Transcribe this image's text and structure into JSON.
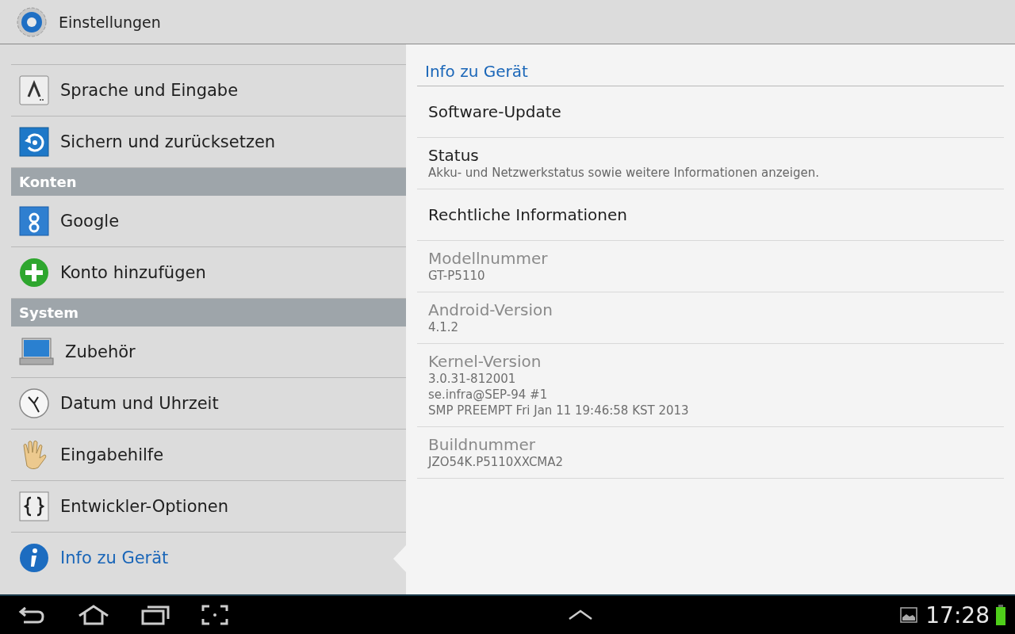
{
  "action_bar": {
    "title": "Einstellungen"
  },
  "sidebar": [
    {
      "kind": "item",
      "label": "Sprache und Eingabe",
      "selected": false
    },
    {
      "kind": "item",
      "label": "Sichern und zurücksetzen",
      "selected": false
    },
    {
      "kind": "header",
      "label": "Konten"
    },
    {
      "kind": "item",
      "label": "Google",
      "selected": false
    },
    {
      "kind": "item",
      "label": "Konto hinzufügen",
      "selected": false
    },
    {
      "kind": "header",
      "label": "System"
    },
    {
      "kind": "item",
      "label": "Zubehör",
      "selected": false
    },
    {
      "kind": "item",
      "label": "Datum und Uhrzeit",
      "selected": false
    },
    {
      "kind": "item",
      "label": "Eingabehilfe",
      "selected": false
    },
    {
      "kind": "item",
      "label": "Entwickler-Optionen",
      "selected": false
    },
    {
      "kind": "item",
      "label": "Info zu Gerät",
      "selected": true
    }
  ],
  "detail": {
    "title": "Info zu Gerät",
    "items": [
      {
        "title": "Software-Update",
        "disabled": false
      },
      {
        "title": "Status",
        "summary": [
          "Akku- und Netzwerkstatus sowie weitere Informationen anzeigen."
        ],
        "disabled": false
      },
      {
        "title": "Rechtliche Informationen",
        "disabled": false
      },
      {
        "title": "Modellnummer",
        "summary": [
          "GT-P5110"
        ],
        "disabled": true
      },
      {
        "title": "Android-Version",
        "summary": [
          "4.1.2"
        ],
        "disabled": true
      },
      {
        "title": "Kernel-Version",
        "summary": [
          "3.0.31-812001",
          "se.infra@SEP-94 #1",
          "SMP PREEMPT Fri Jan 11 19:46:58 KST 2013"
        ],
        "disabled": true
      },
      {
        "title": "Buildnummer",
        "summary": [
          "JZO54K.P5110XXCMA2"
        ],
        "disabled": true
      }
    ]
  },
  "navigation_bar": {
    "time": "17:28"
  }
}
